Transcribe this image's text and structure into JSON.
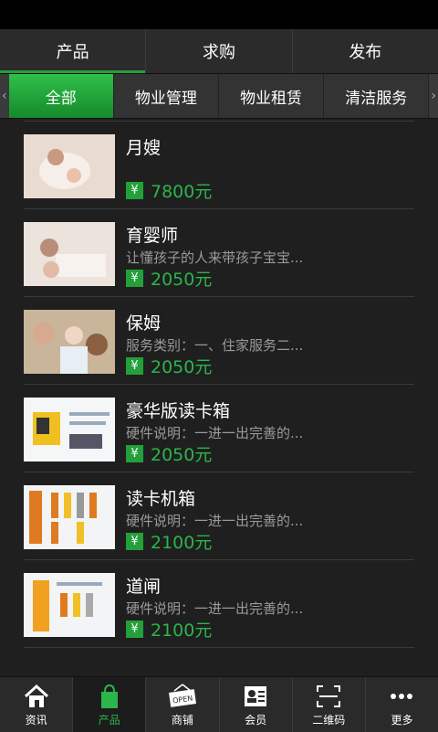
{
  "top_tabs": [
    {
      "label": "产品"
    },
    {
      "label": "求购"
    },
    {
      "label": "发布"
    }
  ],
  "categories": [
    {
      "label": "全部"
    },
    {
      "label": "物业管理"
    },
    {
      "label": "物业租赁"
    },
    {
      "label": "清洁服务"
    }
  ],
  "items": [
    {
      "title": "月嫂",
      "desc": "",
      "price": "7800元"
    },
    {
      "title": "育婴师",
      "desc": "让懂孩子的人来带孩子宝宝...",
      "price": "2050元"
    },
    {
      "title": "保姆",
      "desc": "服务类别：一、住家服务二...",
      "price": "2050元"
    },
    {
      "title": "豪华版读卡箱",
      "desc": "硬件说明：一进一出完善的...",
      "price": "2050元"
    },
    {
      "title": "读卡机箱",
      "desc": "硬件说明：一进一出完善的...",
      "price": "2100元"
    },
    {
      "title": "道闸",
      "desc": "硬件说明：一进一出完善的...",
      "price": "2100元"
    }
  ],
  "currency_symbol": "¥",
  "bottom_nav": [
    {
      "label": "资讯",
      "icon": "home-icon"
    },
    {
      "label": "产品",
      "icon": "shopping-bag-icon"
    },
    {
      "label": "商铺",
      "icon": "open-sign-icon"
    },
    {
      "label": "会员",
      "icon": "member-card-icon"
    },
    {
      "label": "二维码",
      "icon": "qr-scan-icon"
    },
    {
      "label": "更多",
      "icon": "more-dots-icon"
    }
  ],
  "colors": {
    "accent": "#23a03a",
    "background": "#1f1f1f"
  }
}
